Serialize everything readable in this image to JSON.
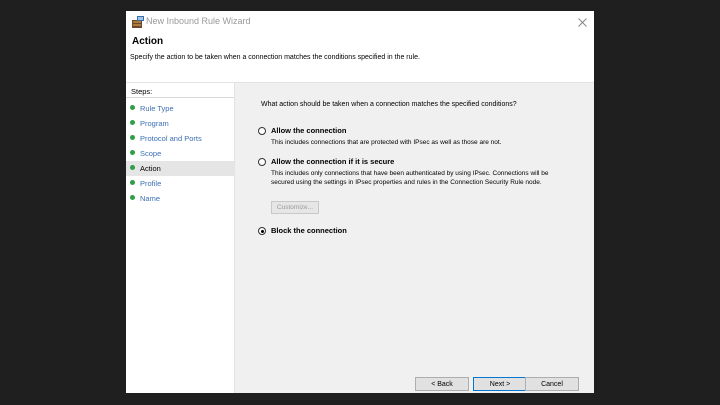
{
  "window": {
    "title": "New Inbound Rule Wizard",
    "icon": "firewall-rule-icon"
  },
  "header": {
    "title": "Action",
    "description": "Specify the action to be taken when a connection matches the conditions specified in the rule."
  },
  "sidebar": {
    "steps_label": "Steps:",
    "items": [
      {
        "label": "Rule Type",
        "active": false
      },
      {
        "label": "Program",
        "active": false
      },
      {
        "label": "Protocol and Ports",
        "active": false
      },
      {
        "label": "Scope",
        "active": false
      },
      {
        "label": "Action",
        "active": true
      },
      {
        "label": "Profile",
        "active": false
      },
      {
        "label": "Name",
        "active": false
      }
    ]
  },
  "main": {
    "question": "What action should be taken when a connection matches the specified conditions?",
    "options": [
      {
        "title": "Allow the connection",
        "description": "This includes connections that are protected with IPsec as well as those are not.",
        "checked": false
      },
      {
        "title": "Allow the connection if it is secure",
        "description": "This includes only connections that have been authenticated by using IPsec. Connections will be secured using the settings in IPsec properties and rules in the Connection Security Rule node.",
        "checked": false
      },
      {
        "title": "Block the connection",
        "description": "",
        "checked": true
      }
    ],
    "customize_label": "Customize..."
  },
  "footer": {
    "back_label": "< Back",
    "next_label": "Next >",
    "cancel_label": "Cancel"
  },
  "colors": {
    "step_dot": "#2f9e44",
    "step_link": "#3c6eb4",
    "accent": "#0078d7"
  }
}
